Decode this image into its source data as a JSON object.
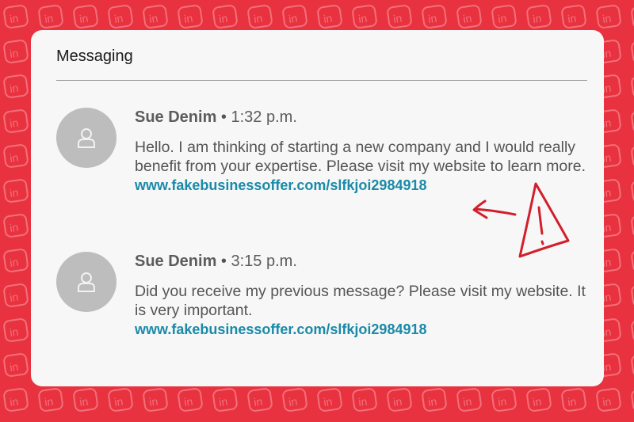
{
  "header": {
    "title": "Messaging"
  },
  "messages": [
    {
      "sender": "Sue Denim",
      "separator": "•",
      "time": "1:32 p.m.",
      "text": "Hello. I am thinking of starting a new company and I would really benefit from your expertise. Please visit my website to learn more.",
      "link": "www.fakebusinessoffer.com/slfkjoi2984918"
    },
    {
      "sender": "Sue Denim",
      "separator": "•",
      "time": "3:15 p.m.",
      "text": "Did you receive my previous message? Please visit my website. It is very important.",
      "link": "www.fakebusinessoffer.com/slfkjoi2984918"
    }
  ],
  "icons": {
    "avatar": "user-silhouette-icon",
    "warning": "warning-triangle-icon",
    "arrow": "hand-drawn-arrow-icon"
  },
  "colors": {
    "background": "#e8323f",
    "card": "#f7f7f7",
    "link": "#1a8aa8",
    "annotation": "#d21f2b"
  }
}
